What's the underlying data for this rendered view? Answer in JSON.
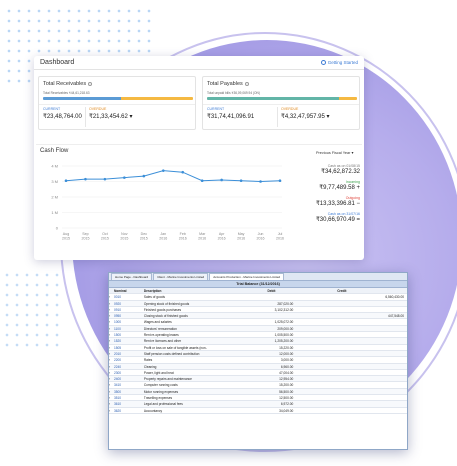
{
  "dashboard": {
    "title": "Dashboard",
    "getting_started": "Getting Started",
    "receivables": {
      "title": "Total Receivables",
      "subtitle": "Total Receivables ₹44,61,218.63",
      "current_label": "CURRENT",
      "current_value": "₹23,48,764.00",
      "overdue_label": "OVERDUE",
      "overdue_value": "₹21,33,454.62",
      "current_fraction": 0.52,
      "colors": {
        "current": "#5b9bd5",
        "overdue": "#f5b942"
      }
    },
    "payables": {
      "title": "Total Payables",
      "subtitle": "Total unpaid bills ₹36,09,069.94 (ON)",
      "current_label": "CURRENT",
      "current_value": "₹31,74,41,096.91",
      "overdue_label": "OVERDUE",
      "overdue_value": "₹4,32,47,957.95",
      "current_fraction": 0.88,
      "colors": {
        "current": "#62b5a7",
        "overdue": "#f5b942"
      }
    },
    "cashflow": {
      "title": "Cash Flow",
      "period": "Previous Fiscal Year",
      "cash_start_label": "Cash as on 01/08/15",
      "cash_start_value": "₹34,62,872.32",
      "incoming_label": "Incoming",
      "incoming_value": "₹9,77,489.58",
      "outgoing_label": "Outgoing",
      "outgoing_value": "₹13,33,396.81",
      "cash_end_label": "Cash as on 31/07/16",
      "cash_end_value": "₹30,66,970.49"
    }
  },
  "chart_data": {
    "type": "line",
    "categories": [
      "Aug 2015",
      "Sep 2015",
      "Oct 2015",
      "Nov 2015",
      "Dec 2015",
      "Jan 2016",
      "Feb 2016",
      "Mar 2016",
      "Apr 2016",
      "May 2016",
      "Jun 2016",
      "Jul 2016"
    ],
    "values": [
      3.05,
      3.15,
      3.15,
      3.25,
      3.35,
      3.7,
      3.6,
      3.05,
      3.1,
      3.05,
      3.0,
      3.05
    ],
    "yticks": [
      "4 M",
      "3 M",
      "2 M",
      "1 M",
      "0"
    ],
    "ylim": [
      0,
      4
    ],
    "color": "#3c8fd8",
    "grid": true
  },
  "trial_balance": {
    "tabs": [
      "Home Page - Dashboard",
      "Client - Marine Investments Limited",
      "Accounts Production - Marine Investments Limited"
    ],
    "active_tab": 2,
    "title": "Trial Balance (31/12/2016)",
    "columns": {
      "nominal": "Nominal",
      "description": "Description",
      "debit": "Debit",
      "credit": "Credit"
    },
    "rows": [
      {
        "nominal": "0010",
        "description": "Sales of goods",
        "debit": "",
        "credit": "6,560,430.00"
      },
      {
        "nominal": "0920",
        "description": "Opening stock of finished goods",
        "debit": "287,020.00",
        "credit": ""
      },
      {
        "nominal": "0910",
        "description": "Finished goods purchases",
        "debit": "3,102,312.00",
        "credit": ""
      },
      {
        "nominal": "0950",
        "description": "Closing stock of finished goods",
        "debit": "",
        "credit": "447,548.00"
      },
      {
        "nominal": "1000",
        "description": "Wages and salaries",
        "debit": "1,025,072.00",
        "credit": ""
      },
      {
        "nominal": "1100",
        "description": "Directors' remuneration",
        "debit": "209,000.00",
        "credit": ""
      },
      {
        "nominal": "1500",
        "description": "Rent re-operating leases",
        "debit": "1,005,500.00",
        "credit": ""
      },
      {
        "nominal": "1520",
        "description": "Rent re licences and other",
        "debit": "1,205,200.00",
        "credit": ""
      },
      {
        "nominal": "1505",
        "description": "Profit or loss on sale of tangible assets (non-",
        "debit": "15,220.00",
        "credit": ""
      },
      {
        "nominal": "2010",
        "description": "Staff pension costs defined contribution",
        "debit": "12,000.00",
        "credit": ""
      },
      {
        "nominal": "2200",
        "description": "Rates",
        "debit": "3,000.00",
        "credit": ""
      },
      {
        "nominal": "2240",
        "description": "Cleaning",
        "debit": "6,960.00",
        "credit": ""
      },
      {
        "nominal": "2300",
        "description": "Power, light and heat",
        "debit": "47,004.00",
        "credit": ""
      },
      {
        "nominal": "2400",
        "description": "Property repairs and maintenance",
        "debit": "12,954.00",
        "credit": ""
      },
      {
        "nominal": "3410",
        "description": "Computer running costs",
        "debit": "15,200.00",
        "credit": ""
      },
      {
        "nominal": "3500",
        "description": "Motor running expenses",
        "debit": "56,500.00",
        "credit": ""
      },
      {
        "nominal": "3510",
        "description": "Travelling expenses",
        "debit": "12,500.00",
        "credit": ""
      },
      {
        "nominal": "3610",
        "description": "Legal and professional fees",
        "debit": "6,972.00",
        "credit": ""
      },
      {
        "nominal": "3620",
        "description": "Accountancy",
        "debit": "34,049.00",
        "credit": ""
      }
    ]
  }
}
